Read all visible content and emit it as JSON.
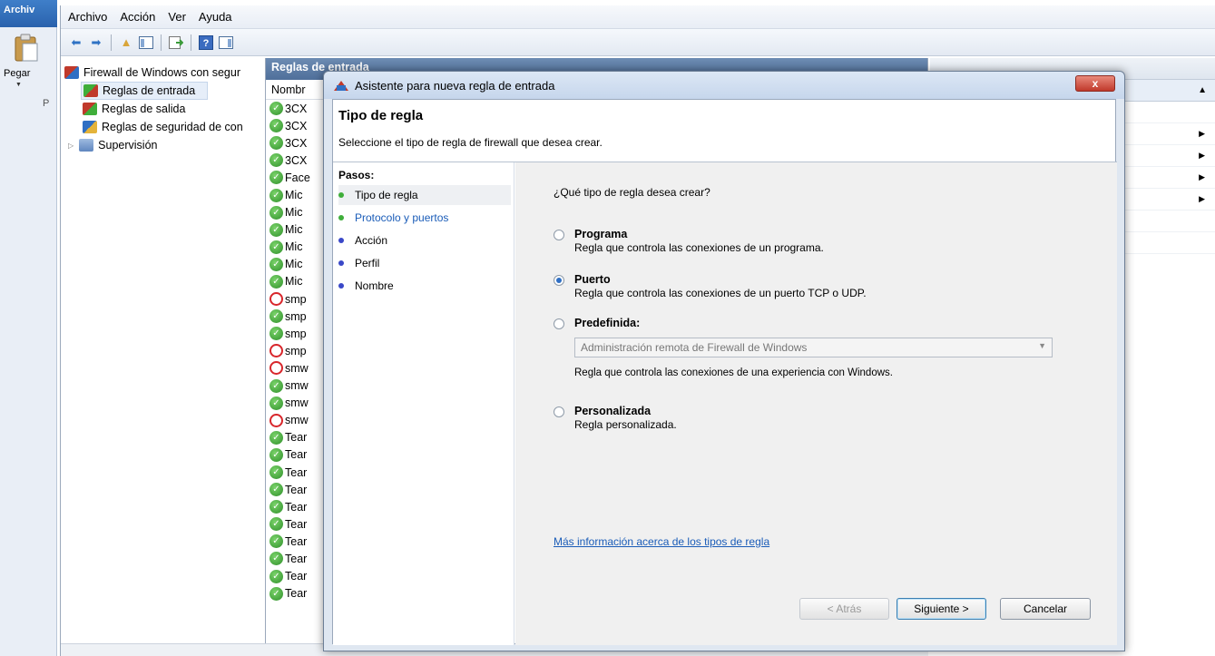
{
  "word": {
    "file_tab": "Archiv",
    "paste_label": "Pegar",
    "clipboard_initial": "P"
  },
  "mmc": {
    "menu": [
      "Archivo",
      "Acción",
      "Ver",
      "Ayuda"
    ],
    "tree": {
      "root": "Firewall de Windows con segur",
      "items": [
        "Reglas de entrada",
        "Reglas de salida",
        "Reglas de seguridad de con",
        "Supervisión"
      ]
    },
    "list": {
      "header": "Reglas de entrada",
      "column": "Nombr",
      "rows": [
        {
          "text": "3CX",
          "status": "allow"
        },
        {
          "text": "3CX",
          "status": "allow"
        },
        {
          "text": "3CX",
          "status": "allow"
        },
        {
          "text": "3CX",
          "status": "allow"
        },
        {
          "text": "Face",
          "status": "allow"
        },
        {
          "text": "Mic",
          "status": "allow"
        },
        {
          "text": "Mic",
          "status": "allow"
        },
        {
          "text": "Mic",
          "status": "allow"
        },
        {
          "text": "Mic",
          "status": "allow"
        },
        {
          "text": "Mic",
          "status": "allow"
        },
        {
          "text": "Mic",
          "status": "allow"
        },
        {
          "text": "smp",
          "status": "block"
        },
        {
          "text": "smp",
          "status": "allow"
        },
        {
          "text": "smp",
          "status": "allow"
        },
        {
          "text": "smp",
          "status": "block"
        },
        {
          "text": "smw",
          "status": "block"
        },
        {
          "text": "smw",
          "status": "allow"
        },
        {
          "text": "smw",
          "status": "allow"
        },
        {
          "text": "smw",
          "status": "block"
        },
        {
          "text": "Tear",
          "status": "allow"
        },
        {
          "text": "Tear",
          "status": "allow"
        },
        {
          "text": "Tear",
          "status": "allow"
        },
        {
          "text": "Tear",
          "status": "allow"
        },
        {
          "text": "Tear",
          "status": "allow"
        },
        {
          "text": "Tear",
          "status": "allow"
        },
        {
          "text": "Tear",
          "status": "allow"
        },
        {
          "text": "Tear",
          "status": "allow"
        },
        {
          "text": "Tear",
          "status": "allow"
        },
        {
          "text": "Tear",
          "status": "allow"
        }
      ]
    }
  },
  "wizard": {
    "title": "Asistente para nueva regla de entrada",
    "close_label": "x",
    "heading": "Tipo de regla",
    "description": "Seleccione el tipo de regla de firewall que desea crear.",
    "steps_label": "Pasos:",
    "steps": [
      {
        "label": "Tipo de regla",
        "dot_color": "#3fae3a",
        "text_color": "#000000"
      },
      {
        "label": "Protocolo y puertos",
        "dot_color": "#3fae3a",
        "text_color": "#1a5cb8"
      },
      {
        "label": "Acción",
        "dot_color": "#3a48c8",
        "text_color": "#000000"
      },
      {
        "label": "Perfil",
        "dot_color": "#3a48c8",
        "text_color": "#000000"
      },
      {
        "label": "Nombre",
        "dot_color": "#3a48c8",
        "text_color": "#000000"
      }
    ],
    "question": "¿Qué tipo de regla desea crear?",
    "options": [
      {
        "title": "Programa",
        "desc": "Regla que controla las conexiones de un programa.",
        "checked": false
      },
      {
        "title": "Puerto",
        "desc": "Regla que controla las conexiones de un puerto TCP o UDP.",
        "checked": true
      },
      {
        "title": "Predefinida:",
        "desc": "",
        "checked": false
      },
      {
        "title": "Personalizada",
        "desc": "Regla personalizada.",
        "checked": false
      }
    ],
    "predefined_value": "Administración remota de Firewall de Windows",
    "predefined_desc": "Regla que controla las conexiones de una experiencia con Windows.",
    "more_info": "Más información acerca de los tipos de regla",
    "buttons": {
      "back": "< Atrás",
      "next": "Siguiente >",
      "cancel": "Cancelar"
    }
  }
}
